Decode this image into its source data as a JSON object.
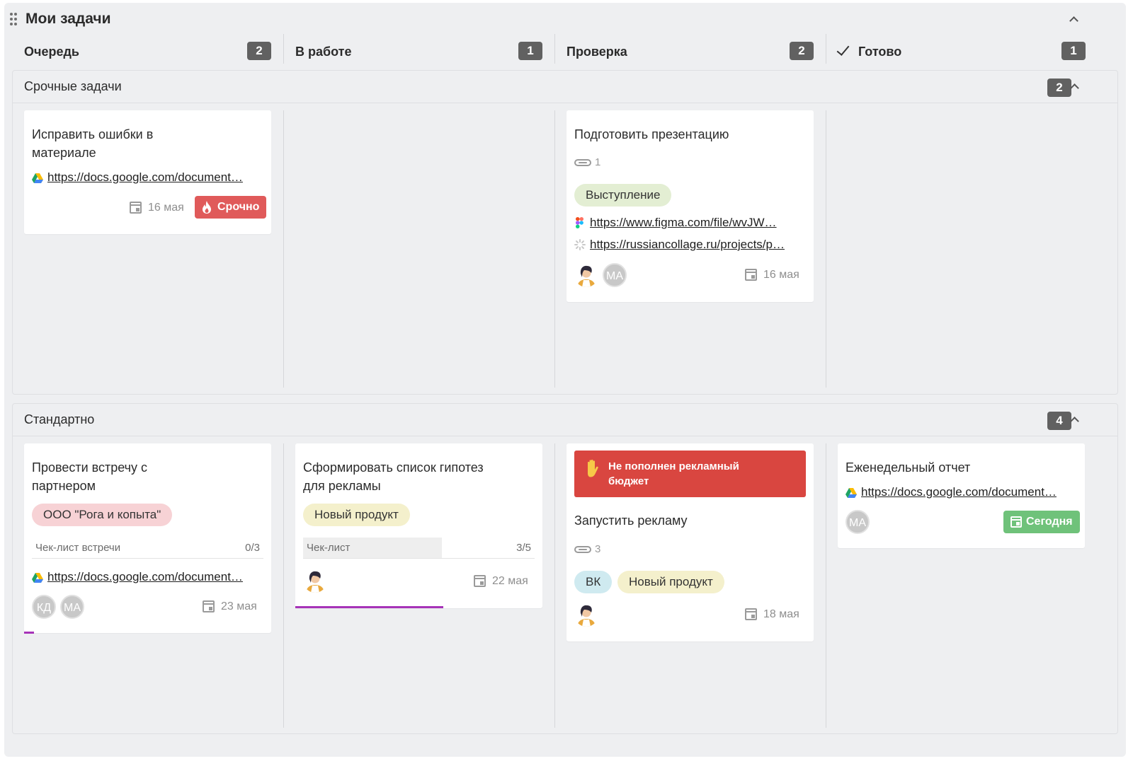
{
  "board": {
    "title": "Мои задачи"
  },
  "columns": [
    {
      "label": "Очередь",
      "count": "2"
    },
    {
      "label": "В работе",
      "count": "1"
    },
    {
      "label": "Проверка",
      "count": "2"
    },
    {
      "label": "Готово",
      "count": "1"
    }
  ],
  "lanes": [
    {
      "title": "Срочные задачи",
      "count": "2"
    },
    {
      "title": "Стандартно",
      "count": "4"
    }
  ],
  "cards": {
    "fix_errors": {
      "title": "Исправить ошибки в материале",
      "link": "https://docs.google.com/document…",
      "date": "16 мая",
      "badge": "Срочно"
    },
    "presentation": {
      "title": "Подготовить презентацию",
      "attachments": "1",
      "tag": "Выступление",
      "link1": "https://www.figma.com/file/wvJW…",
      "link2": "https://russiancollage.ru/projects/p…",
      "avatar2": "МА",
      "date": "16 мая"
    },
    "meeting": {
      "title": "Провести встречу с партнером",
      "tag": "ООО \"Рога и копыта\"",
      "checklist_name": "Чек-лист встречи",
      "checklist_progress": "0/3",
      "checklist_fraction": 0,
      "link": "https://docs.google.com/document…",
      "avatar1": "КД",
      "avatar2": "МА",
      "date": "23 мая"
    },
    "hypotheses": {
      "title": "Сформировать список гипотез для рекламы",
      "tag": "Новый продукт",
      "checklist_name": "Чек-лист",
      "checklist_progress": "3/5",
      "checklist_fraction": 0.6,
      "date": "22 мая"
    },
    "ads": {
      "blocker": "Не пополнен рекламный бюджет",
      "title": "Запустить рекламу",
      "attachments": "3",
      "tag1": "ВК",
      "tag2": "Новый продукт",
      "date": "18 мая"
    },
    "weekly": {
      "title": "Еженедельный отчет",
      "link": "https://docs.google.com/document…",
      "avatar": "МА",
      "badge": "Сегодня"
    }
  },
  "colors": {
    "urgent": "#e05a5a",
    "today": "#6fc27a",
    "blocker": "#d94640",
    "progress": "#a633b8",
    "count_badge": "#616161"
  }
}
